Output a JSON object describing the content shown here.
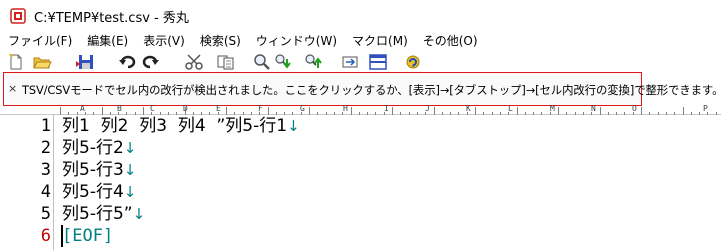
{
  "window": {
    "title": "C:¥TEMP¥test.csv - 秀丸"
  },
  "menu": [
    {
      "label": "ファイル(F)"
    },
    {
      "label": "編集(E)"
    },
    {
      "label": "表示(V)"
    },
    {
      "label": "検索(S)"
    },
    {
      "label": "ウィンドウ(W)"
    },
    {
      "label": "マクロ(M)"
    },
    {
      "label": "その他(O)"
    }
  ],
  "toolbar": {
    "icons": [
      "new-file-icon",
      "open-folder-icon",
      "save-icon",
      "undo-icon",
      "redo-icon",
      "cut-icon",
      "copy-icon",
      "paste-icon",
      "search-icon",
      "find-next-down-icon",
      "find-next-up-icon",
      "jump-icon",
      "split-window-icon",
      "macro-icon"
    ]
  },
  "infobar": {
    "close": "×",
    "message": "TSV/CSVモードでセル内の改行が検出されました。ここをクリックするか、[表示]→[タブストップ]→[セル内改行の変換]で整形できます。"
  },
  "ruler": {
    "letters": [
      "A",
      "B",
      "C",
      "D",
      "E",
      "F",
      "G",
      "H",
      "I",
      "J",
      "K",
      "L",
      "M",
      "N",
      "O",
      "P"
    ]
  },
  "editor": {
    "lines": [
      {
        "number": "1",
        "text": "列1  列2  列3  列4  ”列5-行1",
        "newline": "↓"
      },
      {
        "number": "2",
        "text": "列5-行2",
        "newline": "↓"
      },
      {
        "number": "3",
        "text": "列5-行3",
        "newline": "↓"
      },
      {
        "number": "4",
        "text": "列5-行4",
        "newline": "↓"
      },
      {
        "number": "5",
        "text": "列5-行5”",
        "newline": "↓"
      },
      {
        "number": "6",
        "text": "[EOF]",
        "newline": ""
      }
    ]
  },
  "colors": {
    "accent_border": "#e01818",
    "newline_mark": "#008080",
    "active_line_number": "#c00000"
  }
}
